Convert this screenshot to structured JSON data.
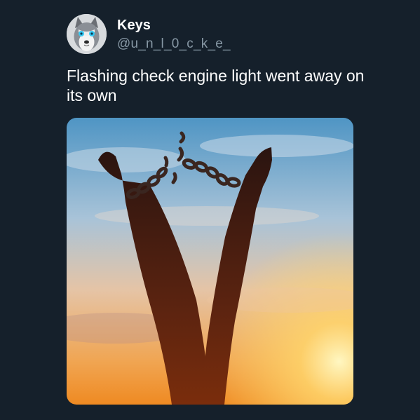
{
  "tweet": {
    "author": {
      "display_name": "Keys",
      "handle": "@u_n_l_0_c_k_e_",
      "avatar_icon": "husky-dog-avatar"
    },
    "text": "Flashing check engine light went away on its own",
    "media": {
      "kind": "photo",
      "subject": "silhouette of raised legs with broken chains against sunset sky"
    }
  },
  "colors": {
    "background": "#15202b",
    "name": "#ffffff",
    "handle": "#8899a6",
    "text": "#ffffff"
  }
}
